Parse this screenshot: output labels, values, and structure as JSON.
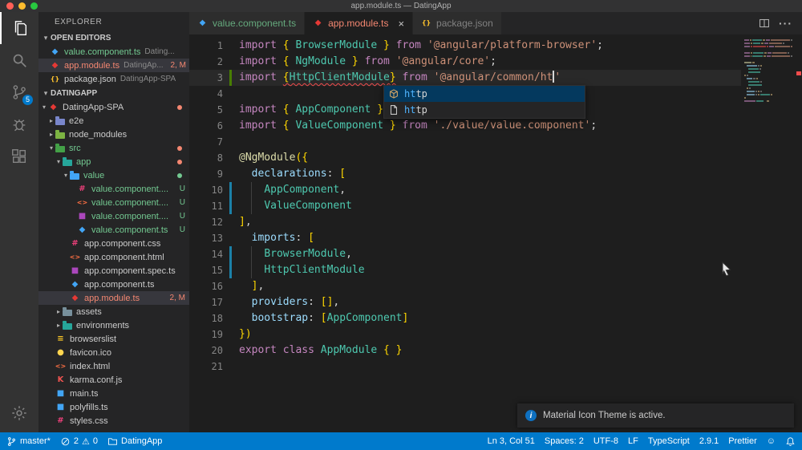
{
  "window": {
    "title": "app.module.ts — DatingApp"
  },
  "activity_bar": {
    "items": [
      {
        "icon": "explorer",
        "active": true
      },
      {
        "icon": "search"
      },
      {
        "icon": "source-control",
        "badge": "5"
      },
      {
        "icon": "debug"
      },
      {
        "icon": "extensions"
      }
    ],
    "bottom": [
      {
        "icon": "settings"
      }
    ]
  },
  "sidebar": {
    "title": "EXPLORER",
    "open_editors_header": "OPEN EDITORS",
    "project_header": "DATINGAPP",
    "open_editors": [
      {
        "label": "value.component.ts",
        "dir": "Dating...",
        "icon": "ng-blue",
        "label_class": "green"
      },
      {
        "label": "app.module.ts",
        "dir": "DatingAp...",
        "icon": "ng-red",
        "label_class": "red",
        "badge": "2, M",
        "selected": true
      },
      {
        "label": "package.json",
        "dir": "DatingApp-SPA",
        "icon": "json"
      }
    ],
    "tree": [
      {
        "label": "DatingApp-SPA",
        "depth": 0,
        "chevron": "down",
        "icon": "ng-red",
        "dot": "#f48771"
      },
      {
        "label": "e2e",
        "depth": 1,
        "chevron": "right",
        "icon": "folder",
        "icon_color": "#7986cb"
      },
      {
        "label": "node_modules",
        "depth": 1,
        "chevron": "right",
        "icon": "folder",
        "icon_color": "#7cb342"
      },
      {
        "label": "src",
        "depth": 1,
        "chevron": "down",
        "icon": "folder",
        "icon_color": "#43a047",
        "label_class": "green",
        "dot": "#f48771"
      },
      {
        "label": "app",
        "depth": 2,
        "chevron": "down",
        "icon": "folder",
        "icon_color": "#26a69a",
        "label_class": "green",
        "dot": "#f48771"
      },
      {
        "label": "value",
        "depth": 3,
        "chevron": "down",
        "icon": "folder",
        "icon_color": "#42a5f5",
        "label_class": "green",
        "dot": "#73c991"
      },
      {
        "label": "value.component....",
        "depth": 4,
        "icon": "css",
        "label_class": "green",
        "badge": "U"
      },
      {
        "label": "value.component....",
        "depth": 4,
        "icon": "html",
        "label_class": "green",
        "badge": "U"
      },
      {
        "label": "value.component....",
        "depth": 4,
        "icon": "spec",
        "label_class": "green",
        "badge": "U"
      },
      {
        "label": "value.component.ts",
        "depth": 4,
        "icon": "ng-blue",
        "label_class": "green",
        "badge": "U"
      },
      {
        "label": "app.component.css",
        "depth": 3,
        "icon": "css"
      },
      {
        "label": "app.component.html",
        "depth": 3,
        "icon": "html"
      },
      {
        "label": "app.component.spec.ts",
        "depth": 3,
        "icon": "spec"
      },
      {
        "label": "app.component.ts",
        "depth": 3,
        "icon": "ng-blue"
      },
      {
        "label": "app.module.ts",
        "depth": 3,
        "icon": "ng-red",
        "label_class": "red",
        "badge": "2, M",
        "selected": true
      },
      {
        "label": "assets",
        "depth": 2,
        "chevron": "right",
        "icon": "folder",
        "icon_color": "#78909c"
      },
      {
        "label": "environments",
        "depth": 2,
        "chevron": "right",
        "icon": "folder",
        "icon_color": "#26a69a"
      },
      {
        "label": "browserslist",
        "depth": 1,
        "icon": "list"
      },
      {
        "label": "favicon.ico",
        "depth": 1,
        "icon": "image"
      },
      {
        "label": "index.html",
        "depth": 1,
        "icon": "html"
      },
      {
        "label": "karma.conf.js",
        "depth": 1,
        "icon": "karma"
      },
      {
        "label": "main.ts",
        "depth": 1,
        "icon": "ts"
      },
      {
        "label": "polyfills.ts",
        "depth": 1,
        "icon": "ts"
      },
      {
        "label": "styles.css",
        "depth": 1,
        "icon": "css"
      }
    ]
  },
  "tabs": [
    {
      "label": "value.component.ts",
      "icon": "ng-blue",
      "label_class": "green"
    },
    {
      "label": "app.module.ts",
      "icon": "ng-red",
      "label_class": "red",
      "active": true,
      "close": true
    },
    {
      "label": "package.json",
      "icon": "json"
    }
  ],
  "editor": {
    "lines": [
      {
        "n": 1,
        "t": [
          [
            "kw",
            "import "
          ],
          [
            "br",
            "{ "
          ],
          [
            "id",
            "BrowserModule"
          ],
          [
            "br",
            " } "
          ],
          [
            "kw",
            "from "
          ],
          [
            "str",
            "'@angular/platform-browser'"
          ],
          [
            "pn",
            ";"
          ]
        ]
      },
      {
        "n": 2,
        "t": [
          [
            "kw",
            "import "
          ],
          [
            "br",
            "{ "
          ],
          [
            "id",
            "NgModule"
          ],
          [
            "br",
            " } "
          ],
          [
            "kw",
            "from "
          ],
          [
            "str",
            "'@angular/core'"
          ],
          [
            "pn",
            ";"
          ]
        ]
      },
      {
        "n": 3,
        "cur": true,
        "g": "add",
        "t": [
          [
            "kw",
            "import "
          ],
          [
            "err-br",
            "{"
          ],
          [
            "err-id",
            "HttpClientModule"
          ],
          [
            "err-br",
            "}"
          ],
          [
            "kw",
            " from "
          ],
          [
            "str",
            "'@angular/common/ht"
          ],
          [
            "cur",
            ""
          ],
          [
            "str",
            "'"
          ]
        ]
      },
      {
        "n": 4,
        "t": []
      },
      {
        "n": 5,
        "t": [
          [
            "kw",
            "import "
          ],
          [
            "br",
            "{ "
          ],
          [
            "id",
            "AppComponent"
          ],
          [
            "br",
            " } "
          ],
          [
            "kw",
            "from "
          ],
          [
            "str",
            "'./app.component'"
          ],
          [
            "pn",
            ";"
          ]
        ]
      },
      {
        "n": 6,
        "t": [
          [
            "kw",
            "import "
          ],
          [
            "br",
            "{ "
          ],
          [
            "id",
            "ValueComponent"
          ],
          [
            "br",
            " } "
          ],
          [
            "kw",
            "from "
          ],
          [
            "str",
            "'./value/value.component'"
          ],
          [
            "pn",
            ";"
          ]
        ]
      },
      {
        "n": 7,
        "t": []
      },
      {
        "n": 8,
        "t": [
          [
            "dec",
            "@NgModule"
          ],
          [
            "br",
            "({"
          ]
        ]
      },
      {
        "n": 9,
        "t": [
          [
            "pn",
            "  "
          ],
          [
            "prop",
            "declarations"
          ],
          [
            "pn",
            ": "
          ],
          [
            "br",
            "["
          ]
        ]
      },
      {
        "n": 10,
        "g": "mod",
        "guide": true,
        "t": [
          [
            "pn",
            "    "
          ],
          [
            "id",
            "AppComponent"
          ],
          [
            "pn",
            ","
          ]
        ]
      },
      {
        "n": 11,
        "g": "mod",
        "guide": true,
        "t": [
          [
            "pn",
            "    "
          ],
          [
            "id",
            "ValueComponent"
          ]
        ]
      },
      {
        "n": 12,
        "t": [
          [
            "br",
            "]"
          ],
          [
            "pn",
            ","
          ]
        ]
      },
      {
        "n": 13,
        "t": [
          [
            "pn",
            "  "
          ],
          [
            "prop",
            "imports"
          ],
          [
            "pn",
            ": "
          ],
          [
            "br",
            "["
          ]
        ]
      },
      {
        "n": 14,
        "g": "mod",
        "guide": true,
        "t": [
          [
            "pn",
            "    "
          ],
          [
            "id",
            "BrowserModule"
          ],
          [
            "pn",
            ","
          ]
        ]
      },
      {
        "n": 15,
        "g": "mod",
        "guide": true,
        "t": [
          [
            "pn",
            "    "
          ],
          [
            "id",
            "HttpClientModule"
          ]
        ]
      },
      {
        "n": 16,
        "t": [
          [
            "pn",
            "  "
          ],
          [
            "br",
            "]"
          ],
          [
            "pn",
            ","
          ]
        ]
      },
      {
        "n": 17,
        "t": [
          [
            "pn",
            "  "
          ],
          [
            "prop",
            "providers"
          ],
          [
            "pn",
            ": "
          ],
          [
            "br",
            "[]"
          ],
          [
            "pn",
            ","
          ]
        ]
      },
      {
        "n": 18,
        "t": [
          [
            "pn",
            "  "
          ],
          [
            "prop",
            "bootstrap"
          ],
          [
            "pn",
            ": "
          ],
          [
            "br",
            "["
          ],
          [
            "id",
            "AppComponent"
          ],
          [
            "br",
            "]"
          ]
        ]
      },
      {
        "n": 19,
        "t": [
          [
            "br",
            "})"
          ]
        ]
      },
      {
        "n": 20,
        "t": [
          [
            "kw",
            "export class "
          ],
          [
            "id",
            "AppModule"
          ],
          [
            "pn",
            " "
          ],
          [
            "br",
            "{ }"
          ]
        ]
      },
      {
        "n": 21,
        "t": []
      }
    ],
    "suggest": {
      "items": [
        {
          "label": "http",
          "match": "ht",
          "icon": "module",
          "selected": true
        },
        {
          "label": "http",
          "match": "ht",
          "icon": "file"
        }
      ]
    }
  },
  "notification": {
    "text": "Material Icon Theme is active."
  },
  "status_bar": {
    "branch": "master*",
    "errors": "2",
    "warnings": "0",
    "folder": "DatingApp",
    "right_items": [
      "Ln 3, Col 51",
      "Spaces: 2",
      "UTF-8",
      "LF",
      "TypeScript",
      "2.9.1",
      "Prettier"
    ]
  }
}
